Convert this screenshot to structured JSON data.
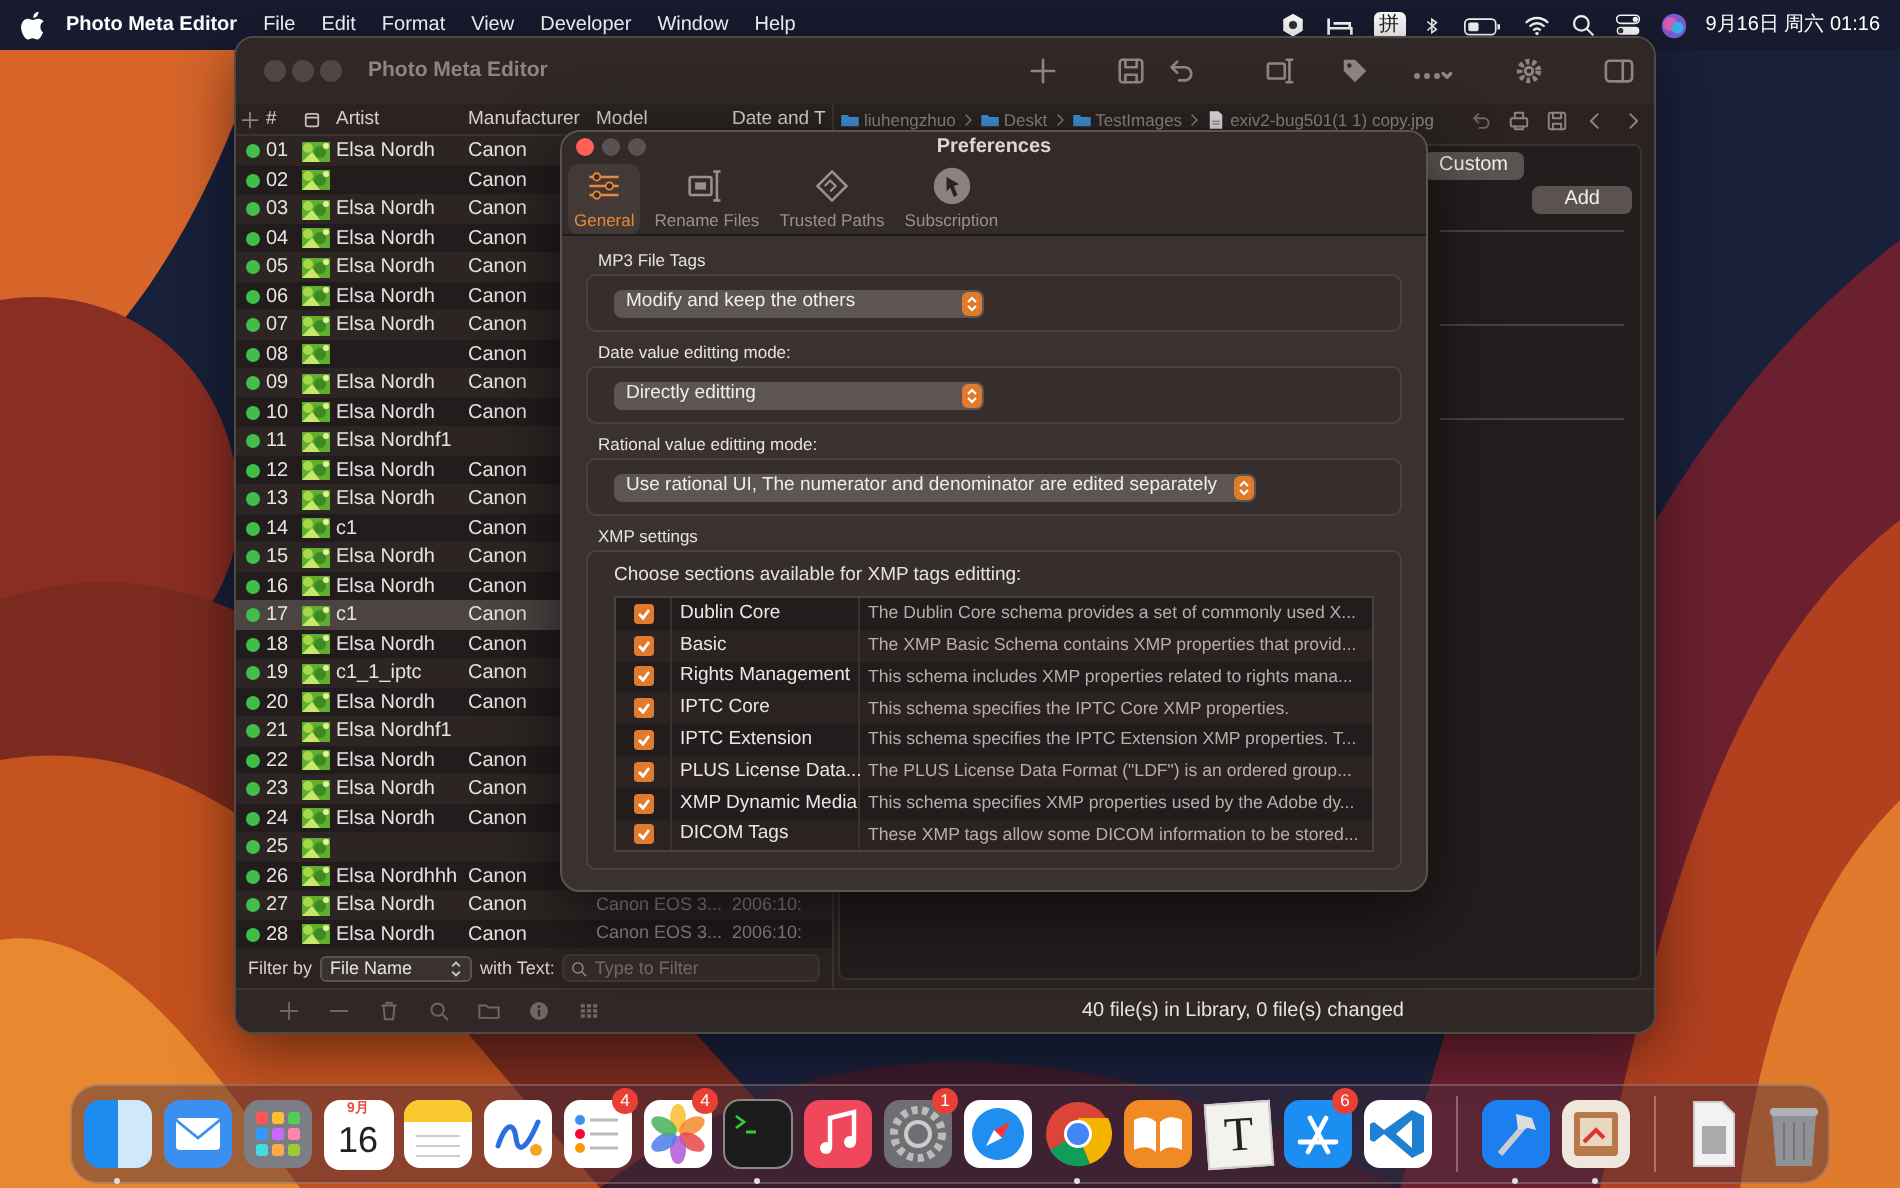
{
  "menubar": {
    "app_name": "Photo Meta Editor",
    "menus": [
      "File",
      "Edit",
      "Format",
      "View",
      "Developer",
      "Window",
      "Help"
    ],
    "input_method": "拼",
    "clock": "9月16日 周六 01:16"
  },
  "main_window": {
    "title": "Photo Meta Editor",
    "table": {
      "columns": [
        "#",
        "Artist",
        "Manufacturer",
        "Model",
        "Date and T"
      ],
      "rows": [
        {
          "number": "01",
          "artist": "Elsa Nordh",
          "manufacturer": "Canon",
          "selected": false
        },
        {
          "number": "02",
          "manufacturer": "Canon",
          "selected": false
        },
        {
          "number": "03",
          "artist": "Elsa Nordh",
          "manufacturer": "Canon",
          "selected": false
        },
        {
          "number": "04",
          "artist": "Elsa Nordh",
          "manufacturer": "Canon",
          "selected": false
        },
        {
          "number": "05",
          "artist": "Elsa Nordh",
          "manufacturer": "Canon",
          "selected": false
        },
        {
          "number": "06",
          "artist": "Elsa Nordh",
          "manufacturer": "Canon",
          "selected": false
        },
        {
          "number": "07",
          "artist": "Elsa Nordh",
          "manufacturer": "Canon",
          "selected": false
        },
        {
          "number": "08",
          "manufacturer": "Canon",
          "selected": false
        },
        {
          "number": "09",
          "artist": "Elsa Nordh",
          "manufacturer": "Canon",
          "selected": false
        },
        {
          "number": "10",
          "artist": "Elsa Nordh",
          "manufacturer": "Canon",
          "selected": false
        },
        {
          "number": "11",
          "artist": "Elsa Nordhf1",
          "selected": false
        },
        {
          "number": "12",
          "artist": "Elsa Nordh",
          "manufacturer": "Canon",
          "selected": false
        },
        {
          "number": "13",
          "artist": "Elsa Nordh",
          "manufacturer": "Canon",
          "selected": false
        },
        {
          "number": "14",
          "artist": "c1",
          "manufacturer": "Canon",
          "selected": false
        },
        {
          "number": "15",
          "artist": "Elsa Nordh",
          "manufacturer": "Canon",
          "selected": false
        },
        {
          "number": "16",
          "artist": "Elsa Nordh",
          "manufacturer": "Canon",
          "selected": false
        },
        {
          "number": "17",
          "artist": "c1",
          "manufacturer": "Canon",
          "selected": true
        },
        {
          "number": "18",
          "artist": "Elsa Nordh",
          "manufacturer": "Canon",
          "selected": false
        },
        {
          "number": "19",
          "artist": "c1_1_iptc",
          "manufacturer": "Canon",
          "selected": false
        },
        {
          "number": "20",
          "artist": "Elsa Nordh",
          "manufacturer": "Canon",
          "selected": false
        },
        {
          "number": "21",
          "artist": "Elsa Nordhf1",
          "selected": false
        },
        {
          "number": "22",
          "artist": "Elsa Nordh",
          "manufacturer": "Canon",
          "selected": false
        },
        {
          "number": "23",
          "artist": "Elsa Nordh",
          "manufacturer": "Canon",
          "selected": false
        },
        {
          "number": "24",
          "artist": "Elsa Nordh",
          "manufacturer": "Canon",
          "selected": false
        },
        {
          "number": "25",
          "selected": false
        },
        {
          "number": "26",
          "artist": "Elsa Nordhhh",
          "manufacturer": "Canon",
          "selected": false
        },
        {
          "number": "27",
          "artist": "Elsa Nordh",
          "manufacturer": "Canon",
          "model": "Canon EOS 3...",
          "date": "2006:10:",
          "selected": false
        },
        {
          "number": "28",
          "artist": "Elsa Nordh",
          "manufacturer": "Canon",
          "model": "Canon EOS 3...",
          "date": "2006:10:",
          "selected": false
        }
      ]
    },
    "breadcrumb": [
      "liuhengzhuo",
      "Deskt",
      "TestImages",
      "exiv2-bug501(1 1) copy.jpg"
    ],
    "panel_buttons": [
      "Custom",
      "Add"
    ],
    "filter": {
      "label": "Filter by",
      "field": "File Name",
      "text_label": "with Text:",
      "placeholder": "Type to Filter"
    },
    "status": "40 file(s) in Library, 0 file(s) changed"
  },
  "preferences": {
    "title": "Preferences",
    "tabs": [
      {
        "label": "General",
        "selected": true
      },
      {
        "label": "Rename Files",
        "selected": false
      },
      {
        "label": "Trusted Paths",
        "selected": false
      },
      {
        "label": "Subscription",
        "selected": false
      }
    ],
    "settings": [
      {
        "label": "MP3 File Tags",
        "value": "Modify and keep the others"
      },
      {
        "label": "Date value editting mode:",
        "value": "Directly editting"
      },
      {
        "label": "Rational value editting mode:",
        "value": "Use rational UI, The numerator and denominator are edited separately"
      }
    ],
    "xmp": {
      "label": "XMP settings",
      "prompt": "Choose sections available for XMP tags editting:",
      "sections": [
        {
          "name": "Dublin Core",
          "description": "The Dublin Core schema provides a set of commonly used X...",
          "checked": true
        },
        {
          "name": "Basic",
          "description": "The XMP Basic Schema contains XMP properties that provid...",
          "checked": true
        },
        {
          "name": "Rights Management",
          "description": "This schema includes XMP properties related to rights mana...",
          "checked": true
        },
        {
          "name": "IPTC Core",
          "description": "This schema specifies the IPTC Core XMP properties.",
          "checked": true
        },
        {
          "name": "IPTC Extension",
          "description": "This schema specifies the IPTC Extension XMP properties. T...",
          "checked": true
        },
        {
          "name": "PLUS License Data...",
          "description": "The PLUS License Data Format (\"LDF\") is an ordered group...",
          "checked": true
        },
        {
          "name": "XMP Dynamic Media",
          "description": "This schema specifies XMP properties used by the Adobe dy...",
          "checked": true
        },
        {
          "name": "DICOM Tags",
          "description": "These XMP tags allow some DICOM information to be stored...",
          "checked": true
        }
      ]
    }
  },
  "dock": [
    {
      "running": true
    },
    {
      "running": false
    },
    {
      "running": false
    },
    {
      "month": "9月",
      "day": "16",
      "running": false
    },
    {
      "running": false
    },
    {
      "running": false
    },
    {
      "badge": "4",
      "running": false
    },
    {
      "badge": "4",
      "running": false
    },
    {
      "running": true
    },
    {
      "running": false
    },
    {
      "badge": "1",
      "running": false
    },
    {
      "running": false
    },
    {
      "running": true
    },
    {
      "running": false
    },
    {
      "glyph": "T",
      "running": false
    },
    {
      "badge": "6",
      "running": false
    },
    {
      "running": false
    },
    {
      "running": true
    },
    {
      "running": true
    },
    {
      "running": false
    },
    {
      "running": false
    }
  ]
}
